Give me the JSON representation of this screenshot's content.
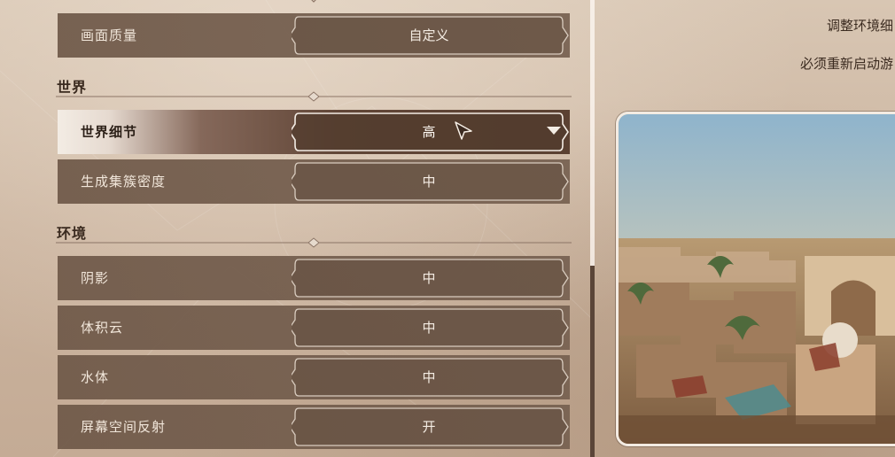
{
  "settings": {
    "quality": {
      "label": "画面质量",
      "value": "自定义"
    },
    "sections": [
      {
        "title": "世界",
        "rows": [
          {
            "label": "世界细节",
            "value": "高",
            "selected": true
          },
          {
            "label": "生成集簇密度",
            "value": "中"
          }
        ]
      },
      {
        "title": "环境",
        "rows": [
          {
            "label": "阴影",
            "value": "中"
          },
          {
            "label": "体积云",
            "value": "中"
          },
          {
            "label": "水体",
            "value": "中"
          },
          {
            "label": "屏幕空间反射",
            "value": "开"
          }
        ]
      }
    ]
  },
  "info": {
    "line1": "调整环境细",
    "line2": "必须重新启动游"
  },
  "colors": {
    "row_bg": "#6e5848",
    "selected_bg": "#5b4132",
    "panel_bg": "#cbb49f",
    "text_light": "#f1e6da",
    "text_dark": "#3a2a1f"
  },
  "icons": [
    "dropdown-arrow-icon",
    "mouse-cursor-icon",
    "diamond-divider-icon"
  ],
  "scroll": {
    "thumb_position": 0.58
  }
}
